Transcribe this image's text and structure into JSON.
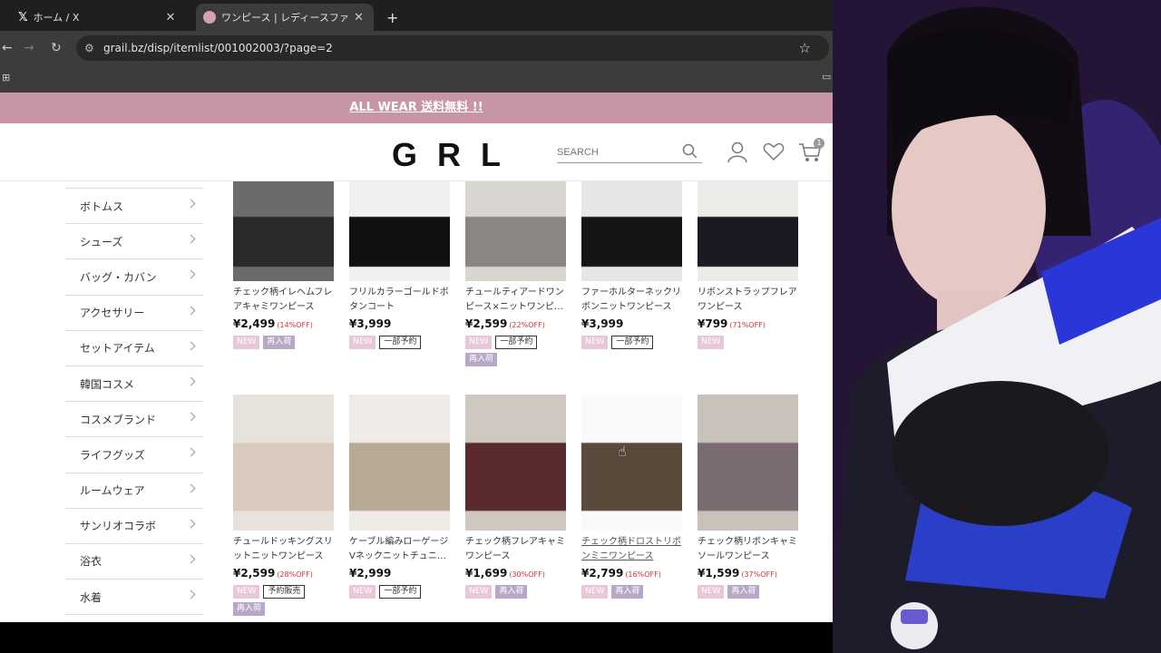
{
  "tabs": [
    {
      "label": "ホーム / X",
      "active": false
    },
    {
      "label": "ワンピース | レディースファッション通販",
      "active": true
    }
  ],
  "address": {
    "url": "grail.bz/disp/itemlist/001002003/?page=2"
  },
  "banner": {
    "text": "ALL WEAR 送料無料 !!"
  },
  "header": {
    "logo": "GRL",
    "search_placeholder": "SEARCH",
    "cart_count": "1"
  },
  "sidebar": {
    "items": [
      {
        "label": "ボトムス"
      },
      {
        "label": "シューズ"
      },
      {
        "label": "バッグ・カバン"
      },
      {
        "label": "アクセサリー"
      },
      {
        "label": "セットアイテム"
      },
      {
        "label": "韓国コスメ"
      },
      {
        "label": "コスメブランド"
      },
      {
        "label": "ライフグッズ"
      },
      {
        "label": "ルームウェア"
      },
      {
        "label": "サンリオコラボ"
      },
      {
        "label": "浴衣"
      },
      {
        "label": "水着"
      }
    ]
  },
  "products": [
    {
      "name": "チェック柄イレヘムフレアキャミワンピース",
      "price": "¥2,499",
      "off": "(14%OFF)",
      "tags": [
        "NEW",
        "再入荷"
      ]
    },
    {
      "name": "フリルカラーゴールドボタンコート",
      "price": "¥3,999",
      "off": "",
      "tags": [
        "NEW",
        "一部予約"
      ]
    },
    {
      "name": "チュールティアードワンピース×ニットワンピ…",
      "price": "¥2,599",
      "off": "(22%OFF)",
      "tags": [
        "NEW",
        "一部予約",
        "再入荷"
      ]
    },
    {
      "name": "ファーホルターネックリボンニットワンピース",
      "price": "¥3,999",
      "off": "",
      "tags": [
        "NEW",
        "一部予約"
      ]
    },
    {
      "name": "リボンストラップフレアワンピース",
      "price": "¥799",
      "off": "(71%OFF)",
      "tags": [
        "NEW"
      ]
    },
    {
      "name": "チュールドッキングスリットニットワンピース",
      "price": "¥2,599",
      "off": "(28%OFF)",
      "tags": [
        "NEW",
        "予約販売",
        "再入荷"
      ]
    },
    {
      "name": "ケーブル編みローゲージVネックニットチュニ…",
      "price": "¥2,999",
      "off": "",
      "tags": [
        "NEW",
        "一部予約"
      ]
    },
    {
      "name": "チェック柄フレアキャミワンピース",
      "price": "¥1,699",
      "off": "(30%OFF)",
      "tags": [
        "NEW",
        "再入荷"
      ]
    },
    {
      "name": "チェック柄ドロストリボンミニワンピース",
      "price": "¥2,799",
      "off": "(16%OFF)",
      "tags": [
        "NEW",
        "再入荷"
      ]
    },
    {
      "name": "チェック柄リボンキャミソールワンピース",
      "price": "¥1,599",
      "off": "(37%OFF)",
      "tags": [
        "NEW",
        "再入荷"
      ]
    }
  ]
}
